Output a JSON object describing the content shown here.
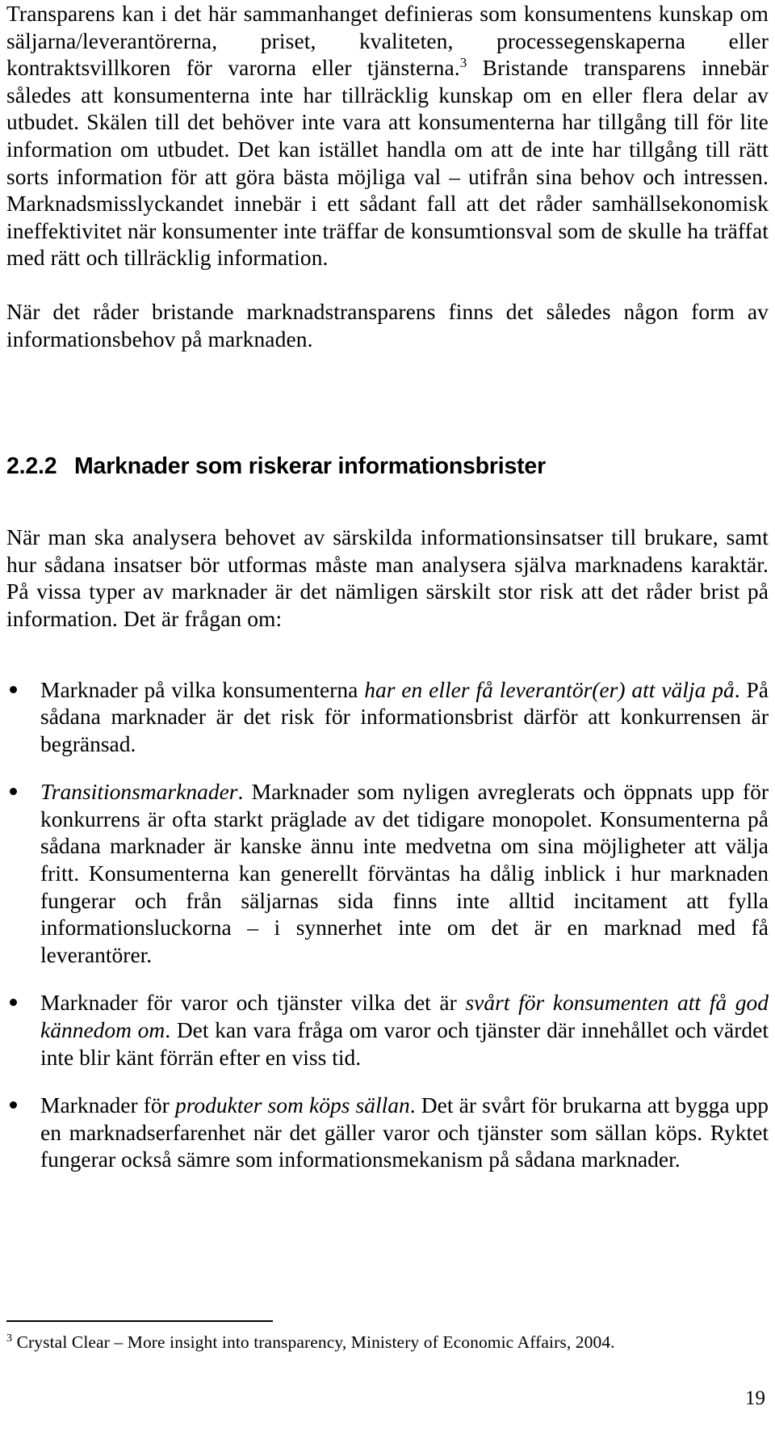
{
  "document": {
    "page_number": "19",
    "body": {
      "paragraph_1": {
        "text_before_note": "Transparens kan i det här sammanhanget definieras som konsumentens kunskap om säljarna/leverantörerna, priset, kvaliteten, processegenskaperna eller kontraktsvillkoren för varorna eller tjänsterna.",
        "footnote_marker": "3",
        "text_after_note": "Bristande transparens innebär således att konsumenterna inte har tillräcklig kunskap om en eller flera delar av utbudet. Skälen till det behöver inte vara att konsumenterna har tillgång till för lite information om utbudet. Det kan istället handla om att de inte har tillgång till rätt sorts information för att göra bästa möjliga val – utifrån sina behov och intressen. Marknadsmisslyckandet innebär i ett sådant fall att det råder samhällsekonomisk ineffektivitet när konsumenter inte träffar de konsumtionsval som de skulle ha träffat med rätt och tillräcklig information."
      },
      "paragraph_2": {
        "text": "När det råder bristande marknadstransparens finns det således någon form av informationsbehov på marknaden."
      },
      "heading": {
        "number": "2.2.2",
        "title": "Marknader som riskerar informationsbrister"
      },
      "paragraph_3": {
        "text": "När man ska analysera behovet av särskilda informationsinsatser till brukare, samt hur sådana insatser bör utformas måste man analysera själva marknadens karaktär. På vissa typer av marknader är det nämligen särskilt stor risk att det råder brist på information. Det är frågan om:"
      },
      "bullets": [
        {
          "lead_plain": "Marknader på vilka konsumenterna ",
          "lead_italic": "har en eller få leverantör(er) att välja på",
          "rest": ". På sådana marknader är det risk för informationsbrist därför att konkurrensen är begränsad."
        },
        {
          "lead_plain": "",
          "lead_italic": "Transitionsmarknader",
          "rest": ". Marknader som nyligen avreglerats och öppnats upp för konkurrens är ofta starkt präglade av det tidigare monopolet. Konsumenterna på sådana marknader är kanske ännu inte medvetna om sina möjligheter att välja fritt. Konsumenterna kan generellt förväntas ha dålig inblick i hur marknaden fungerar och från säljarnas sida finns inte alltid incitament att fylla informationsluckorna – i synnerhet inte om det är en marknad med få leverantörer."
        },
        {
          "lead_plain": "Marknader för varor och tjänster vilka det är ",
          "lead_italic": "svårt för konsumenten att få god kännedom om",
          "rest": ". Det kan vara fråga om varor och tjänster där innehållet och värdet inte blir känt förrän efter en viss tid."
        },
        {
          "lead_plain": "Marknader för ",
          "lead_italic": "produkter som köps sällan",
          "rest": ". Det är svårt för brukarna att bygga upp en marknadserfarenhet när det gäller varor och tjänster som sällan köps. Ryktet fungerar också sämre som informationsmekanism på sådana marknader."
        }
      ],
      "footnote": {
        "marker": "3",
        "text": "Crystal Clear – More insight into transparency, Ministery of Economic Affairs, 2004."
      }
    }
  }
}
